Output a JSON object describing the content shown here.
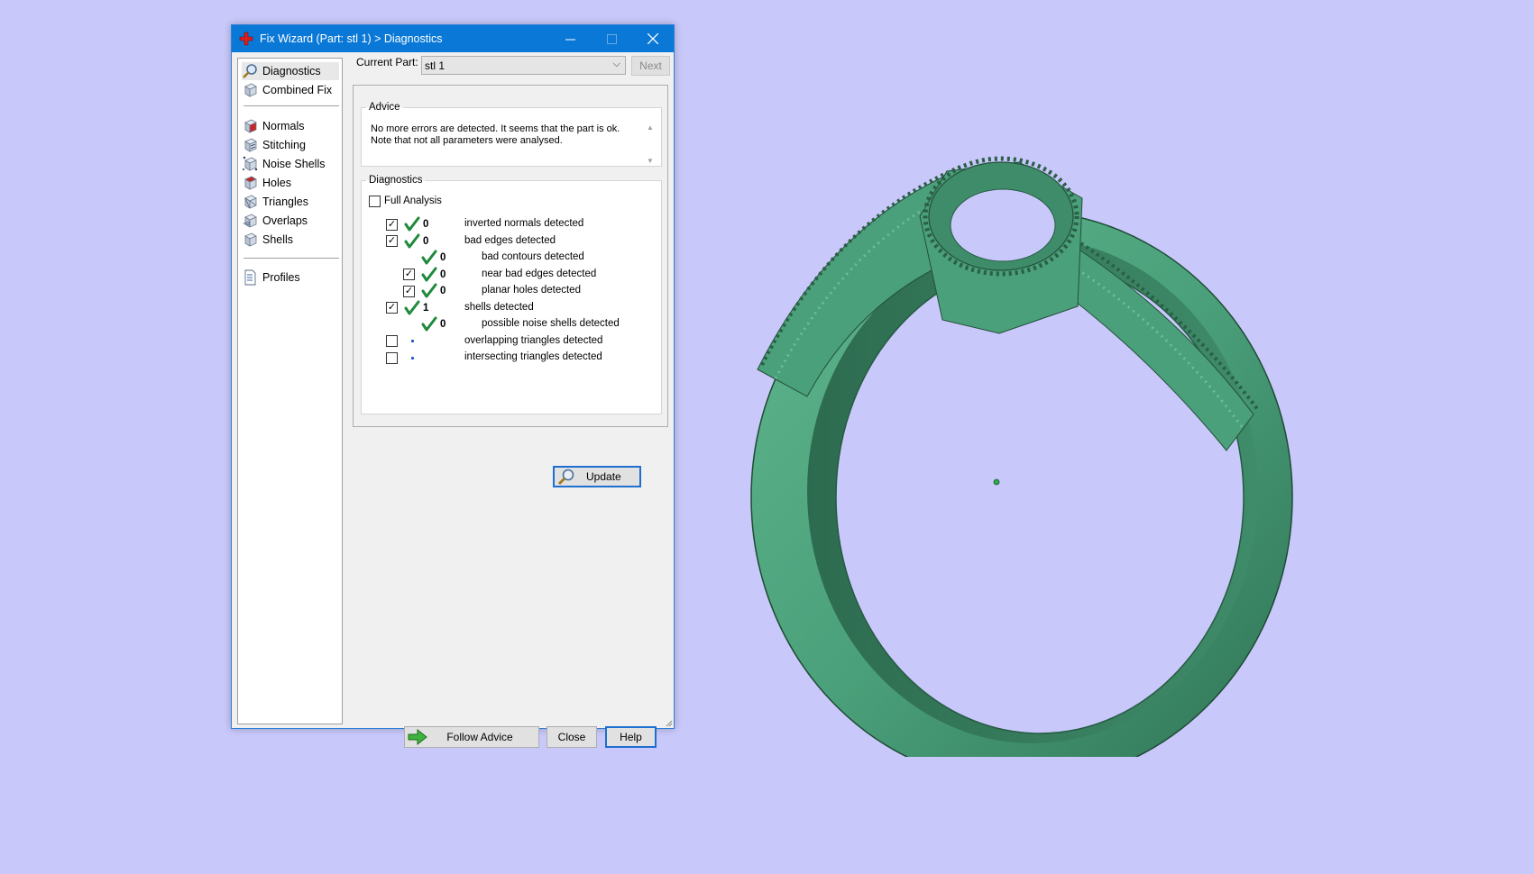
{
  "window": {
    "title": "Fix Wizard (Part: stl 1) > Diagnostics",
    "minimize_icon": "minimize-icon",
    "maximize_icon": "maximize-icon",
    "close_icon": "close-icon"
  },
  "sidebar": {
    "groups": [
      {
        "items": [
          {
            "label": "Diagnostics",
            "icon": "magnifier-icon",
            "selected": true
          },
          {
            "label": "Combined Fix",
            "icon": "cube-icon"
          }
        ]
      },
      {
        "items": [
          {
            "label": "Normals",
            "icon": "cube-red-face-icon"
          },
          {
            "label": "Stitching",
            "icon": "cube-stitch-icon"
          },
          {
            "label": "Noise Shells",
            "icon": "cube-noise-icon"
          },
          {
            "label": "Holes",
            "icon": "cube-hole-icon"
          },
          {
            "label": "Triangles",
            "icon": "cube-triangles-icon"
          },
          {
            "label": "Overlaps",
            "icon": "cube-overlap-icon"
          },
          {
            "label": "Shells",
            "icon": "cube-shells-icon"
          }
        ]
      },
      {
        "items": [
          {
            "label": "Profiles",
            "icon": "document-icon"
          }
        ]
      }
    ]
  },
  "current_part": {
    "label": "Current Part:",
    "value": "stl 1",
    "next_label": "Next"
  },
  "advice": {
    "legend": "Advice",
    "text": "No more errors are detected. It seems that the part is ok.\nNote that not all parameters were analysed."
  },
  "diagnostics": {
    "legend": "Diagnostics",
    "full_analysis_label": "Full Analysis",
    "full_analysis_checked": false,
    "rows": [
      {
        "label": "inverted normals detected",
        "count": "0",
        "checked": true,
        "status": "ok",
        "indent": 0,
        "has_checkbox": true
      },
      {
        "label": "bad edges detected",
        "count": "0",
        "checked": true,
        "status": "ok",
        "indent": 0,
        "has_checkbox": true
      },
      {
        "label": "bad contours detected",
        "count": "0",
        "checked": false,
        "status": "ok",
        "indent": 1,
        "has_checkbox": false
      },
      {
        "label": "near bad edges detected",
        "count": "0",
        "checked": true,
        "status": "ok",
        "indent": 1,
        "has_checkbox": true
      },
      {
        "label": "planar holes detected",
        "count": "0",
        "checked": true,
        "status": "ok",
        "indent": 1,
        "has_checkbox": true
      },
      {
        "label": "shells detected",
        "count": "1",
        "checked": true,
        "status": "ok",
        "indent": 0,
        "has_checkbox": true
      },
      {
        "label": "possible noise shells detected",
        "count": "0",
        "checked": false,
        "status": "ok",
        "indent": 1,
        "has_checkbox": false
      },
      {
        "label": "overlapping triangles detected",
        "count": "",
        "checked": false,
        "status": "pending",
        "indent": 0,
        "has_checkbox": true
      },
      {
        "label": "intersecting triangles detected",
        "count": "",
        "checked": false,
        "status": "pending",
        "indent": 0,
        "has_checkbox": true
      }
    ],
    "update_label": "Update"
  },
  "footer": {
    "follow_advice_label": "Follow Advice",
    "close_label": "Close",
    "help_label": "Help"
  },
  "colors": {
    "titlebar": "#0a78d7",
    "check_green": "#1f8a3c",
    "model_green": "#4aa07a",
    "background": "#c8c8fa"
  }
}
